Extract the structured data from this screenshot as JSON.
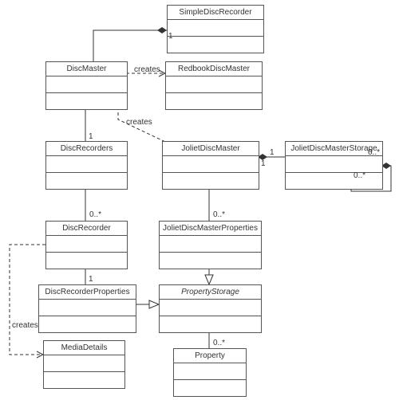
{
  "classes": {
    "simpleDiscRecorder": "SimpleDiscRecorder",
    "discMaster": "DiscMaster",
    "redbookDiscMaster": "RedbookDiscMaster",
    "discRecorders": "DiscRecorders",
    "jolietDiscMaster": "JolietDiscMaster",
    "jolietDiscMasterStorage": "JolietDiscMasterStorage",
    "discRecorder": "DiscRecorder",
    "jolietDiscMasterProperties": "JolietDiscMasterProperties",
    "discRecorderProperties": "DiscRecorderProperties",
    "propertyStorage": "PropertyStorage",
    "mediaDetails": "MediaDetails",
    "property": "Property"
  },
  "labels": {
    "creates1": "creates",
    "creates2": "creates",
    "creates3": "creates"
  },
  "mult": {
    "one_a": "1",
    "one_b": "1",
    "one_c": "1",
    "one_d": "1",
    "one_e": "1",
    "zm_a": "0..*",
    "zm_b": "0..*",
    "zm_c": "0..*",
    "zm_d": "0..*",
    "zm_e": "0..*"
  },
  "chart_data": {
    "type": "uml-class-diagram",
    "classes": [
      {
        "name": "SimpleDiscRecorder",
        "abstract": false
      },
      {
        "name": "DiscMaster",
        "abstract": false
      },
      {
        "name": "RedbookDiscMaster",
        "abstract": false
      },
      {
        "name": "DiscRecorders",
        "abstract": false
      },
      {
        "name": "JolietDiscMaster",
        "abstract": false
      },
      {
        "name": "JolietDiscMasterStorage",
        "abstract": false
      },
      {
        "name": "DiscRecorder",
        "abstract": false
      },
      {
        "name": "JolietDiscMasterProperties",
        "abstract": false
      },
      {
        "name": "DiscRecorderProperties",
        "abstract": false
      },
      {
        "name": "PropertyStorage",
        "abstract": true
      },
      {
        "name": "MediaDetails",
        "abstract": false
      },
      {
        "name": "Property",
        "abstract": false
      }
    ],
    "relationships": [
      {
        "from": "SimpleDiscRecorder",
        "to": "DiscMaster",
        "type": "composition",
        "multiplicity": {
          "from": "",
          "to": "1"
        }
      },
      {
        "from": "DiscMaster",
        "to": "RedbookDiscMaster",
        "type": "dependency",
        "label": "creates"
      },
      {
        "from": "DiscMaster",
        "to": "JolietDiscMaster",
        "type": "dependency",
        "label": "creates"
      },
      {
        "from": "DiscMaster",
        "to": "DiscRecorders",
        "type": "composition",
        "multiplicity": {
          "from": "",
          "to": "1"
        }
      },
      {
        "from": "DiscRecorders",
        "to": "DiscRecorder",
        "type": "composition",
        "multiplicity": {
          "from": "",
          "to": "0..*"
        }
      },
      {
        "from": "DiscRecorder",
        "to": "DiscRecorderProperties",
        "type": "composition",
        "multiplicity": {
          "from": "",
          "to": "1"
        }
      },
      {
        "from": "DiscRecorder",
        "to": "MediaDetails",
        "type": "dependency",
        "label": "creates"
      },
      {
        "from": "DiscRecorderProperties",
        "to": "PropertyStorage",
        "type": "generalization"
      },
      {
        "from": "JolietDiscMaster",
        "to": "JolietDiscMasterProperties",
        "type": "composition",
        "multiplicity": {
          "from": "",
          "to": "0..*"
        }
      },
      {
        "from": "JolietDiscMaster",
        "to": "JolietDiscMasterStorage",
        "type": "composition",
        "multiplicity": {
          "from": "1",
          "to": "0..*"
        }
      },
      {
        "from": "JolietDiscMasterStorage",
        "to": "JolietDiscMasterStorage",
        "type": "composition",
        "multiplicity": {
          "from": "",
          "to": "0..*"
        }
      },
      {
        "from": "JolietDiscMasterProperties",
        "to": "PropertyStorage",
        "type": "generalization"
      },
      {
        "from": "PropertyStorage",
        "to": "Property",
        "type": "composition",
        "multiplicity": {
          "from": "",
          "to": "0..*"
        }
      }
    ]
  }
}
